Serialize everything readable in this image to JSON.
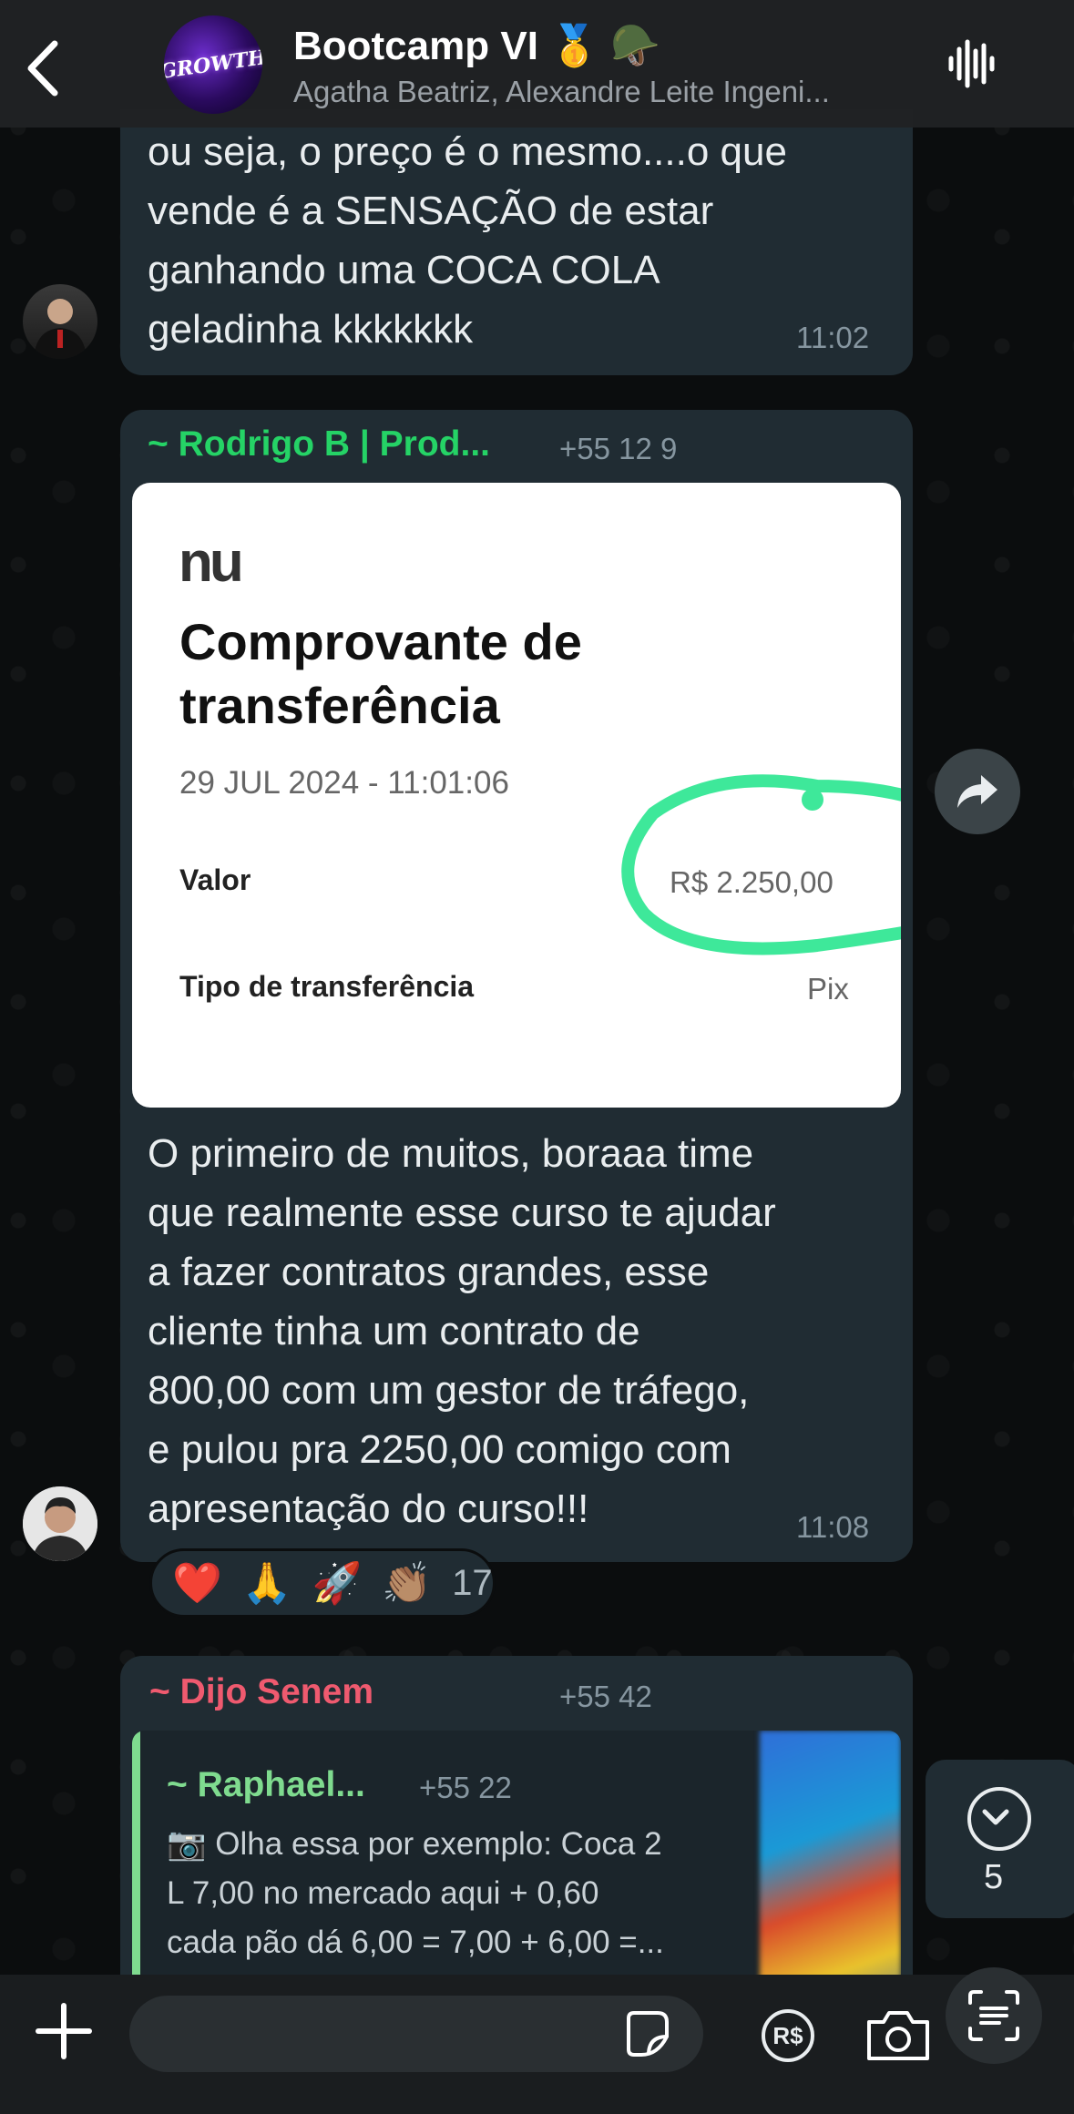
{
  "header": {
    "title": "Bootcamp VI 🥇 🪖",
    "subtitle": "Agatha Beatriz, Alexandre Leite Ingeni...",
    "avatar_text": "GROWTH"
  },
  "messages": [
    {
      "text": "ou seja, o preço é o mesmo....o que\nvende é a SENSAÇÃO de estar\nganhando uma COCA COLA\ngeladinha kkkkkkk",
      "time": "11:02"
    },
    {
      "sender": "~ Rodrigo B | Prod...",
      "sender_color": "#25d366",
      "phone": "+55 12 9",
      "receipt": {
        "logo": "nu",
        "title": "Comprovante de\ntransferência",
        "date": "29 JUL 2024 - 11:01:06",
        "valor_label": "Valor",
        "valor": "R$ 2.250,00",
        "tipo_label": "Tipo de transferência",
        "tipo": "Pix"
      },
      "text": "O primeiro de muitos, boraaa time\nque realmente esse curso te ajudar\na fazer contratos grandes, esse\ncliente tinha um contrato de\n800,00 com um gestor de tráfego,\ne pulou pra 2250,00 comigo com\napresentação do curso!!!",
      "time": "11:08",
      "reactions": [
        "❤️",
        "🙏",
        "🚀",
        "👏🏽"
      ],
      "reaction_count": "17"
    },
    {
      "sender": "~ Dijo Senem",
      "sender_color": "#ef5a6f",
      "phone": "+55 42",
      "quote": {
        "sender": "~ Raphael...",
        "phone": "+55 22",
        "text": "📷 Olha essa por exemplo: Coca 2\nL 7,00 no mercado aqui + 0,60\ncada pão dá 6,00 = 7,00 + 6,00 =..."
      }
    }
  ],
  "scroll_down": {
    "count": "5"
  },
  "footer": {
    "rs_label": "R$"
  }
}
